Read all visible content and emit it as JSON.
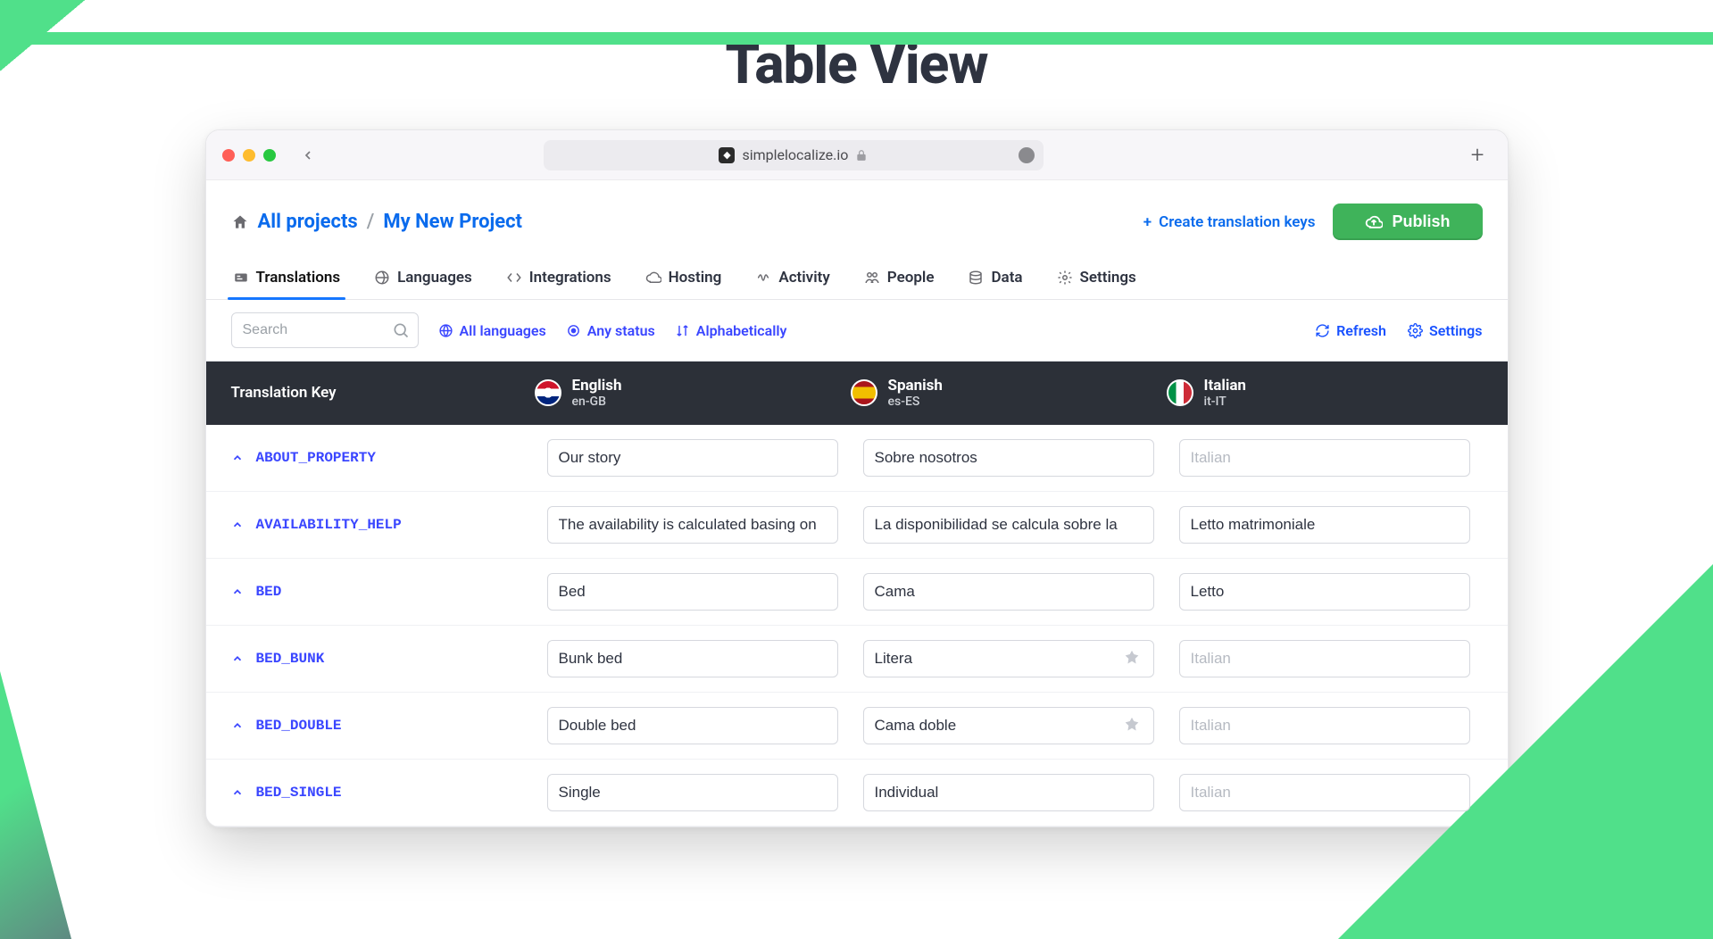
{
  "hero": {
    "title": "Table View"
  },
  "browser": {
    "url": "simplelocalize.io"
  },
  "breadcrumb": {
    "all_projects": "All projects",
    "separator": "/",
    "project": "My New Project"
  },
  "header": {
    "create_keys": "Create translation keys",
    "publish": "Publish"
  },
  "tabs": [
    {
      "label": "Translations",
      "active": true
    },
    {
      "label": "Languages"
    },
    {
      "label": "Integrations"
    },
    {
      "label": "Hosting"
    },
    {
      "label": "Activity"
    },
    {
      "label": "People"
    },
    {
      "label": "Data"
    },
    {
      "label": "Settings"
    }
  ],
  "toolbar": {
    "search_placeholder": "Search",
    "filter_languages": "All languages",
    "filter_status": "Any status",
    "sort": "Alphabetically",
    "refresh": "Refresh",
    "settings": "Settings"
  },
  "columns": {
    "key_header": "Translation Key",
    "langs": [
      {
        "name": "English",
        "code": "en-GB",
        "flag": "uk"
      },
      {
        "name": "Spanish",
        "code": "es-ES",
        "flag": "es"
      },
      {
        "name": "Italian",
        "code": "it-IT",
        "flag": "it"
      }
    ]
  },
  "placeholder_italian": "Italian",
  "rows": [
    {
      "key": "ABOUT_PROPERTY",
      "en": "Our story",
      "es": "Sobre nosotros",
      "it": "",
      "es_auto": false
    },
    {
      "key": "AVAILABILITY_HELP",
      "en": "The availability is calculated basing on",
      "es": "La disponibilidad se calcula sobre la",
      "it": "Letto matrimoniale",
      "es_auto": false
    },
    {
      "key": "BED",
      "en": "Bed",
      "es": "Cama",
      "it": "Letto",
      "es_auto": false
    },
    {
      "key": "BED_BUNK",
      "en": "Bunk bed",
      "es": "Litera",
      "it": "",
      "es_auto": true
    },
    {
      "key": "BED_DOUBLE",
      "en": "Double bed",
      "es": "Cama doble",
      "it": "",
      "es_auto": true
    },
    {
      "key": "BED_SINGLE",
      "en": "Single",
      "es": "Individual",
      "it": "",
      "es_auto": false
    }
  ]
}
